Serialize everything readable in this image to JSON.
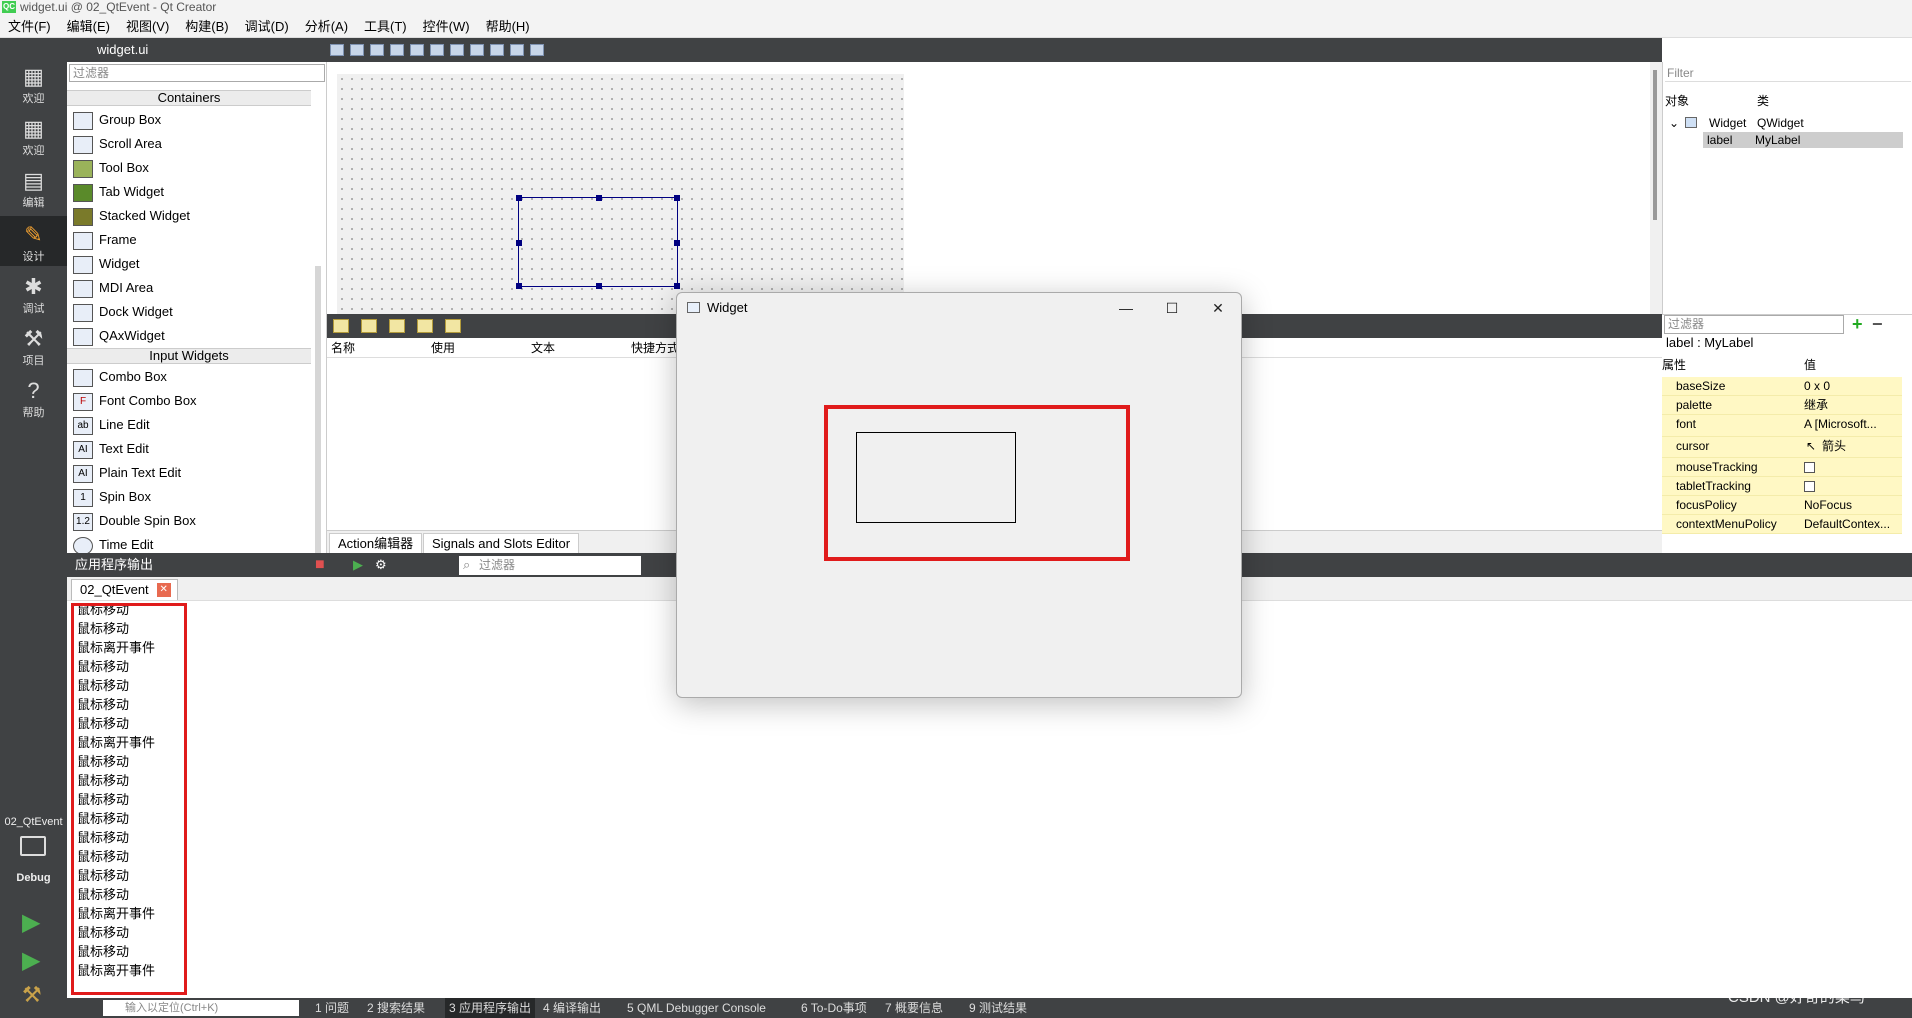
{
  "window": {
    "title": "widget.ui @ 02_QtEvent - Qt Creator",
    "logo": "QC"
  },
  "menu": [
    "文件(F)",
    "编辑(E)",
    "视图(V)",
    "构建(B)",
    "调试(D)",
    "分析(A)",
    "工具(T)",
    "控件(W)",
    "帮助(H)"
  ],
  "modes": [
    {
      "label": "欢迎",
      "icon": "grid-icon"
    },
    {
      "label": "欢迎",
      "icon": "grid-icon"
    },
    {
      "label": "编辑",
      "icon": "document-icon"
    },
    {
      "label": "设计",
      "icon": "pencil-icon"
    },
    {
      "label": "调试",
      "icon": "bug-icon"
    },
    {
      "label": "项目",
      "icon": "wrench-icon"
    },
    {
      "label": "帮助",
      "icon": "help-icon"
    }
  ],
  "kit": {
    "project": "02_QtEvent",
    "mode": "Debug"
  },
  "editor": {
    "file": "widget.ui"
  },
  "widgetbox": {
    "filter_placeholder": "过滤器",
    "categories": [
      "Containers",
      "Input Widgets"
    ],
    "containers": [
      "Group Box",
      "Scroll Area",
      "Tool Box",
      "Tab Widget",
      "Stacked Widget",
      "Frame",
      "Widget",
      "MDI Area",
      "Dock Widget",
      "QAxWidget"
    ],
    "inputs": [
      "Combo Box",
      "Font Combo Box",
      "Line Edit",
      "Text Edit",
      "Plain Text Edit",
      "Spin Box",
      "Double Spin Box",
      "Time Edit"
    ]
  },
  "action_editor": {
    "columns": [
      "名称",
      "使用",
      "文本",
      "快捷方式"
    ],
    "tabs": [
      "Action编辑器",
      "Signals and Slots Editor"
    ]
  },
  "object_inspector": {
    "filter_placeholder": "Filter",
    "columns": [
      "对象",
      "类"
    ],
    "rows": [
      {
        "object": "Widget",
        "class": "QWidget"
      },
      {
        "object": "label",
        "class": "MyLabel"
      }
    ]
  },
  "property_editor": {
    "filter_placeholder": "过滤器",
    "title": "label : MyLabel",
    "columns": [
      "属性",
      "值"
    ],
    "rows": [
      {
        "name": "baseSize",
        "value": "0 x 0"
      },
      {
        "name": "palette",
        "value": "继承"
      },
      {
        "name": "font",
        "value": "A  [Microsoft..."
      },
      {
        "name": "cursor",
        "value": "箭头"
      },
      {
        "name": "mouseTracking",
        "value": ""
      },
      {
        "name": "tabletTracking",
        "value": ""
      },
      {
        "name": "focusPolicy",
        "value": "NoFocus"
      },
      {
        "name": "contextMenuPolicy",
        "value": "DefaultContex..."
      }
    ]
  },
  "output": {
    "title": "应用程序输出",
    "filter_placeholder": "过滤器",
    "tab": "02_QtEvent",
    "lines": [
      "鼠标移动",
      "鼠标移动",
      "鼠标离开事件",
      "鼠标移动",
      "鼠标移动",
      "鼠标移动",
      "鼠标移动",
      "鼠标离开事件",
      "鼠标移动",
      "鼠标移动",
      "鼠标移动",
      "鼠标移动",
      "鼠标移动",
      "鼠标移动",
      "鼠标移动",
      "鼠标移动",
      "鼠标离开事件",
      "鼠标移动",
      "鼠标移动",
      "鼠标离开事件"
    ]
  },
  "statusbar": {
    "locate_placeholder": "输入以定位(Ctrl+K)",
    "items": [
      "1 问题",
      "2 搜索结果",
      "3 应用程序输出",
      "4 编译输出",
      "5 QML Debugger Console",
      "6 To-Do事项",
      "7 概要信息",
      "9 测试结果"
    ]
  },
  "run_window": {
    "title": "Widget",
    "minimize": "—",
    "maximize": "☐",
    "close": "✕"
  },
  "watermark": "CSDN @好奇的菜鸟",
  "colors": {
    "highlight_red": "#e01b1b",
    "sidebar": "#404244",
    "property_yellow": "#fff8c4"
  }
}
